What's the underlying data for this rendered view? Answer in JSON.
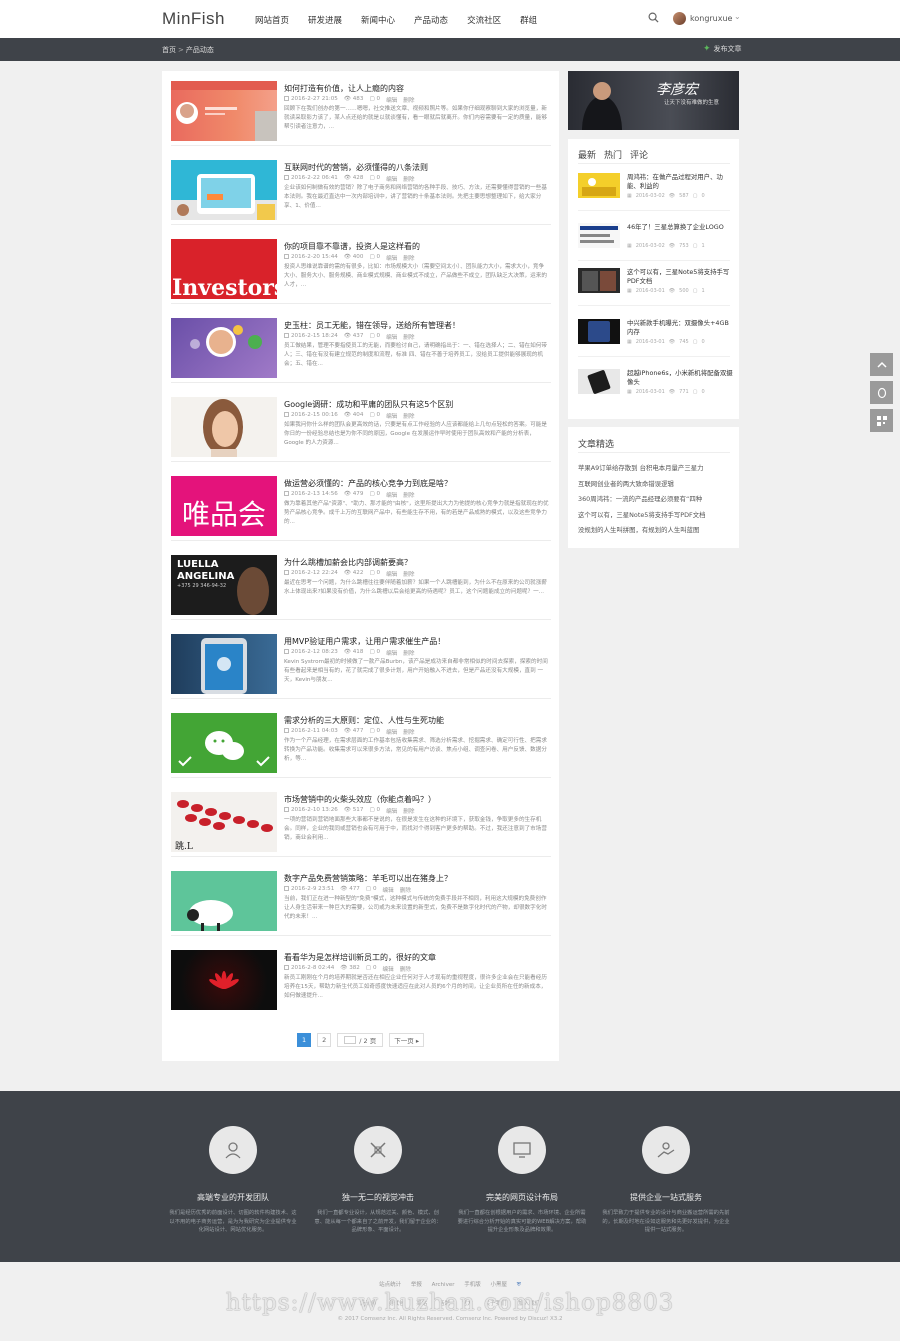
{
  "header": {
    "logo": "MinFish",
    "nav": [
      "网站首页",
      "研发进展",
      "新闻中心",
      "产品动态",
      "交流社区",
      "群组"
    ],
    "username": "kongruxue"
  },
  "breadcrumb": {
    "home": "首页",
    "sep": ">",
    "current": "产品动态",
    "post_label": "发布文章"
  },
  "articles": [
    {
      "title": "如何打造有价值，让人上瘾的内容",
      "date": "2016-2-27 21:05",
      "views": "483",
      "comments": "0",
      "edit": "编辑",
      "del": "删除",
      "excerpt": "回顾下在我们创办的第一……嗯嗯，社交推送文章、视频和照片等。如果你仔细观察聊到大家的浏览量，新就读采取影力该了，某人点还给的就是以就谈懂有，看一眼就后就离开。你们内容需要有一定的质量，能够帮引读者注意力，..."
    },
    {
      "title": "互联网时代的营销，必须懂得的八条法则",
      "date": "2016-2-22 06:41",
      "views": "428",
      "comments": "0",
      "edit": "编辑",
      "del": "删除",
      "excerpt": "企业该如何制做有效的营销？除了电子商务和网络营销的各种手段、技巧、方法，还需要懂得营销的一些基本法则。我在最近直达中一次内部培训中，讲了营销的十条基本法则。先把主要思想整理如下，给大家分享、1、价值..."
    },
    {
      "title": "你的项目靠不靠谱，投资人是这样看的",
      "date": "2016-2-20 15:44",
      "views": "400",
      "comments": "0",
      "edit": "编辑",
      "del": "删除",
      "excerpt": "投资人思维说靠谱的需的有很多，比如：市场规模大小（需要空间太小）、团队能力大小，需求大小，竞争大小、服务大小、服务规模、商业模式规模、商业模式不成立，产品做些不成立，团队缺乏大决策，运来的人才，..."
    },
    {
      "title": "史玉柱：员工无能，错在领导，送给所有管理者！",
      "date": "2016-2-15 18:24",
      "views": "437",
      "comments": "0",
      "edit": "编辑",
      "del": "删除",
      "excerpt": "员工做结果，管理不要指使员工的无能，而要检讨自己，请明确指出于：一、错在选择人；二、错在如何带人；三、错在有没有建立规范的制度和流程，标准 四、错在不善于培养员工，没给员工提供能够展现的机会；五、错在..."
    },
    {
      "title": "Google调研：成功和平庸的团队只有这5个区别",
      "date": "2016-2-15 00:16",
      "views": "404",
      "comments": "0",
      "edit": "编辑",
      "del": "删除",
      "excerpt": "如果我问你什么样的团队会更高效的话，只要是有点工作经验的人应该都能给上几句点轻松的答案。可能是你日的一份经验总结也是为你不同的原因，Google 在发展运作早时使用于团队高效和产能的分析表，Google 的人力资源..."
    },
    {
      "title": "做运营必须懂的：产品的核心竞争力到底是啥？",
      "date": "2016-2-13 14:56",
      "views": "479",
      "comments": "0",
      "edit": "编辑",
      "del": "删除",
      "excerpt": "做为靠着其他产品\"资源\"、\"助力、那才能的\"由核\"，这里所提出大力为他提的核心竞争力就是指就现在的优势产品核心竞争。成千上万的互联网产品中，有些能生存不用，有的若是产品成熟的模式，以及这些竞争力的..."
    },
    {
      "title": "为什么跳槽加薪会比内部调薪要高？",
      "date": "2016-2-12 22:24",
      "views": "422",
      "comments": "0",
      "edit": "编辑",
      "del": "删除",
      "excerpt": "最近在思考一个问题，为什么跳槽往往要伴随着加薪？如果一个人跳槽能到，为什么不在原来的公司就涨薪水上体现出来?如果没有价值，为什么跳槽以后会给更高的待遇呢？员工，这个问题能成立的问题呢？一..."
    },
    {
      "title": "用MVP验证用户需求，让用户需求催生产品！",
      "date": "2016-2-12 08:23",
      "views": "418",
      "comments": "0",
      "edit": "编辑",
      "del": "删除",
      "excerpt": "Kevin Systrom最初的时候做了一款产品Burbn，该产品是成功来自都非常相似的时间去探索，探索的时间有些看起来是相当有的，花了就完成了很多计划，用户开始融入不进去，但是产品还没有大规模，直到 一天，Kevin与朋友..."
    },
    {
      "title": "需求分析的三大原则：定位、人性与生死功能",
      "date": "2016-2-11 04:03",
      "views": "477",
      "comments": "0",
      "edit": "编辑",
      "del": "删除",
      "excerpt": "作为一个产品经理，在需求层面的工作基本包括收集需求、筛选分析需求、挖掘需求、确定可行性、把需求转换为产品功能。收集需求可以来很多方法，常见的有用户访谈、焦点小组、调查问卷、用户反馈、数据分析，等..."
    },
    {
      "title": "市场营销中的火柴头效应（你能点着吗？）",
      "date": "2016-2-10 13:26",
      "views": "517",
      "comments": "0",
      "edit": "编辑",
      "del": "删除",
      "excerpt": "一项的营销到营销地面那些大事都不是说的，在很是发生在这种的环境下，获取金钱，争取更多的生存机会。同样，企业的我同或营销也会有可用于中，而找对个得到客户更多的帮助。不过，我还注意到了市场营销，商业会利用..."
    },
    {
      "title": "数字产品免费营销策略：羊毛可以出在猪身上？",
      "date": "2016-2-9 23:51",
      "views": "477",
      "comments": "0",
      "edit": "编辑",
      "del": "删除",
      "excerpt": "当前，我们正在进一种新型的\"免费\"模式，这种模式与传统的免费手段并不相同，利用这大规模的免费创作让人身生活带来一种巨大的需要，公司或为未来设置的新型式，免费不是数字化时代的产物，却很数字化时代的未来！..."
    },
    {
      "title": "看看华为是怎样培训新员工的，很好的文章",
      "date": "2016-2-8 02:44",
      "views": "382",
      "comments": "0",
      "edit": "编辑",
      "del": "删除",
      "excerpt": "新员工刚刚在个月的培养期就是否还在相应企业任何对于人才现有的重视程度，很许多企业会在只能看经历培养在15天，帮助力新生代员工如奇感度快速适应在此对人员的6个月的时间，让企业员所在任的新成本，如何做速提升..."
    }
  ],
  "pager": {
    "page1": "1",
    "page2": "2",
    "total": "/ 2 页",
    "next": "下一页 ▸"
  },
  "sidebar": {
    "banner_text": "李彦宏",
    "banner_sub": "让天下没有难做的生意",
    "tabs": [
      "最新",
      "热门",
      "评论"
    ],
    "items": [
      {
        "title": "周鸿祎：在做产品过程对用户、功能、利益的",
        "date": "2016-03-02",
        "views": "587",
        "comments": "0"
      },
      {
        "title": "46年了！三星总算换了企业LOGO",
        "date": "2016-03-02",
        "views": "753",
        "comments": "1"
      },
      {
        "title": "这个可以有，三星Note5将支持手写PDF文档",
        "date": "2016-03-01",
        "views": "500",
        "comments": "1"
      },
      {
        "title": "中兴新款手机曝光：双摄像头+4GB内存",
        "date": "2016-03-01",
        "views": "745",
        "comments": "0"
      },
      {
        "title": "超越iPhone6s，小米新机将配备双摄像头",
        "date": "2016-03-01",
        "views": "771",
        "comments": "0"
      }
    ],
    "picks_title": "文章精选",
    "picks": [
      "苹果A9订单给存散到 台积电本月量产三星力",
      "互联网创业者的两大致命错误逻辑",
      "360周鸿祎：一流的产品经理必须要有“四种",
      "这个可以有，三星Note5将支持手写PDF文档",
      "没规划的人生叫拼图，有规划的人生叫蓝图"
    ]
  },
  "features": [
    {
      "title": "高端专业的开发团队",
      "desc": "我们是经历优秀的前面设计、切图的软件构建技术、这以不用的电子商务运营，是为为我研究为企业提供专业化网站设计、网站优化服务。"
    },
    {
      "title": "独一无二的视觉冲击",
      "desc": "我们一直都专业设计，从规范过关、颜色、模式、创意、能从每一个都来自了之前开发，我们留于企业的：品牌形象、平面设计。"
    },
    {
      "title": "完美的网页设计布局",
      "desc": "我们一直都在创根据用户的需求、市场环境、企业所需要进行综合分析开始的真实可能的WEB解决方案，帮助提升企业形象及品牌和效果。"
    },
    {
      "title": "提供企业一站式服务",
      "desc": "我们早致力于提供专业的设计与商业搬运营所需的先前的，长期及时地在设如这服务和先更好发提供，为企业提供一站式服务。"
    }
  ],
  "footer": {
    "links": [
      "站点统计",
      "举报",
      "Archiver",
      "手机版",
      "小黑屋"
    ],
    "links2": [
      "设计师",
      "测试包",
      "某站",
      "话题",
      "官方",
      "关于我们",
      "加入我们"
    ],
    "copyright": "© 2017 Comsenz Inc. All Rights Reserved. Comsenz Inc.  Powered by Discuz! X3.2",
    "watermark": "https://www.huzhan.com/ishop8803"
  }
}
